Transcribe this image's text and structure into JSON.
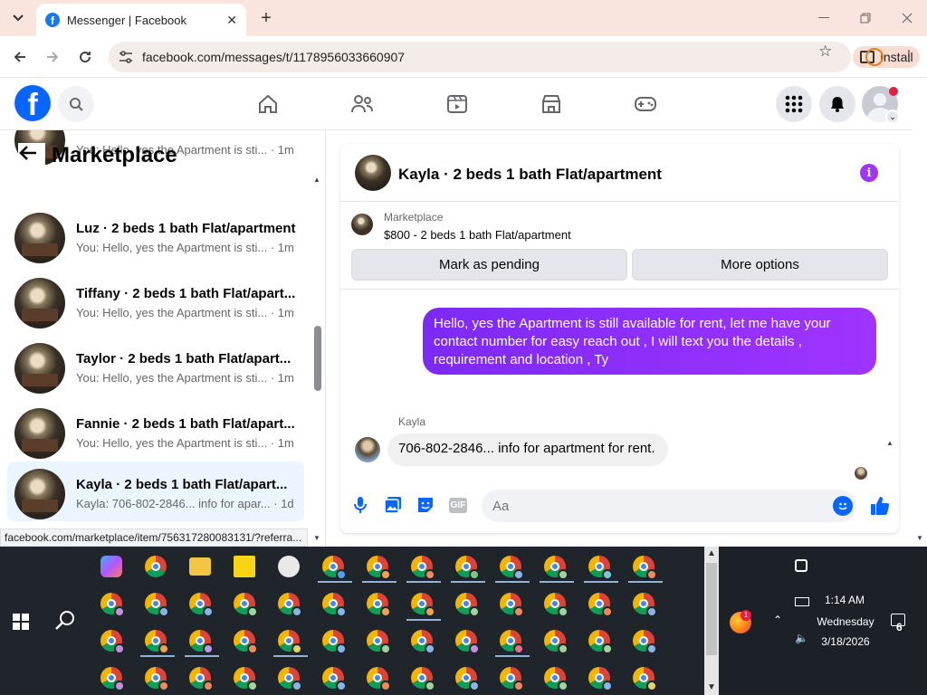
{
  "browser": {
    "tab_title": "Messenger | Facebook",
    "tab_favicon": "f",
    "url": "facebook.com/messages/t/1178956033660907",
    "install_label": "Install",
    "status_url": "facebook.com/marketplace/item/756317280083131/?referra..."
  },
  "header": {
    "logo_letter": "f"
  },
  "left": {
    "title": "Marketplace",
    "conversations": [
      {
        "name": "",
        "preview": "You: Hello, yes the Apartment is sti... · 1m"
      },
      {
        "name": "Luz · 2 beds 1 bath Flat/apartment",
        "preview": "You: Hello, yes the Apartment is sti... · 1m"
      },
      {
        "name": "Tiffany · 2 beds 1 bath Flat/apart...",
        "preview": "You: Hello, yes the Apartment is sti... · 1m"
      },
      {
        "name": "Taylor · 2 beds 1 bath Flat/apart...",
        "preview": "You: Hello, yes the Apartment is sti... · 1m"
      },
      {
        "name": "Fannie · 2 beds 1 bath Flat/apart...",
        "preview": "You: Hello, yes the Apartment is sti... · 1m"
      },
      {
        "name": "Kayla · 2 beds 1 bath Flat/apart...",
        "preview": "Kayla: 706-802-2846... info for apar... · 1d"
      }
    ]
  },
  "chat": {
    "title": "Kayla · 2 beds 1 bath Flat/apartment",
    "info_glyph": "i",
    "marketplace_label": "Marketplace",
    "listing": "$800 - 2 beds 1 bath Flat/apartment",
    "btn_pending": "Mark as pending",
    "btn_more": "More options",
    "outgoing": "Hello, yes the Apartment  is still available for rent, let me have your contact number for easy reach out , I will text you the details , requirement and location , Ty",
    "sender": "Kayla",
    "incoming": "706-802-2846... info for apartment for rent.",
    "input_placeholder": "Aa",
    "gif_label": "GIF"
  },
  "taskbar": {
    "time": "1:14 AM",
    "day": "Wednesday",
    "date": "3/18/2026",
    "notifications": "6",
    "firefox_badge": "1"
  },
  "colors": {
    "fb_blue": "#0866ff",
    "messenger_purple": "#a033ff",
    "active_conv": "#ebf5ff"
  }
}
